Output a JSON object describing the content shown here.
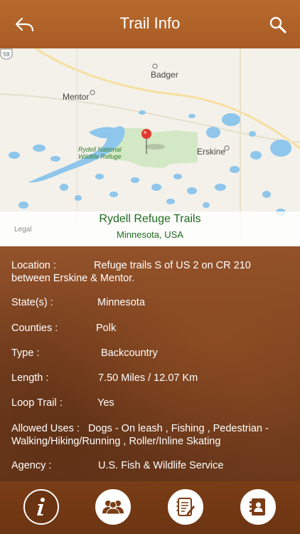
{
  "header": {
    "title": "Trail Info",
    "back_icon": "back-arrow-icon",
    "search_icon": "search-icon"
  },
  "map": {
    "places": [
      "Badger",
      "Mentor",
      "Erskine"
    ],
    "refuge_label_line1": "Rydell National",
    "refuge_label_line2": "Wildlife Refuge",
    "trail_name": "Rydell Refuge Trails",
    "trail_region": "Minnesota, USA",
    "legal": "Legal",
    "highway_shield": "59",
    "pin_color": "#e03a2f"
  },
  "details": {
    "location_label": "Location  :",
    "location_value": "Refuge trails S of US 2 on CR 210",
    "location_value_cont": "between Erskine & Mentor.",
    "states_label": "State(s)  :",
    "states_value": "Minnesota",
    "counties_label": "Counties  :",
    "counties_value": "Polk",
    "type_label": "Type  :",
    "type_value": "Backcountry",
    "length_label": "Length  :",
    "length_value": "7.50 Miles / 12.07 Km",
    "loop_label": "Loop Trail  :",
    "loop_value": "Yes",
    "uses_label": "Allowed Uses  :",
    "uses_value": "Dogs - On leash , Fishing , Pedestrian -",
    "uses_value_cont": "Walking/Hiking/Running , Roller/Inline Skating",
    "agency_label": "Agency  :",
    "agency_value": "U.S. Fish & Wildlife Service"
  },
  "tabs": [
    {
      "icon": "info-icon"
    },
    {
      "icon": "group-icon"
    },
    {
      "icon": "notes-icon"
    },
    {
      "icon": "contacts-icon"
    }
  ],
  "colors": {
    "header": "#b06328",
    "body": "#7a4520",
    "map_water": "#8ec6ec",
    "refuge_green": "#d3e8c4",
    "label_green": "#1e6b1e"
  }
}
